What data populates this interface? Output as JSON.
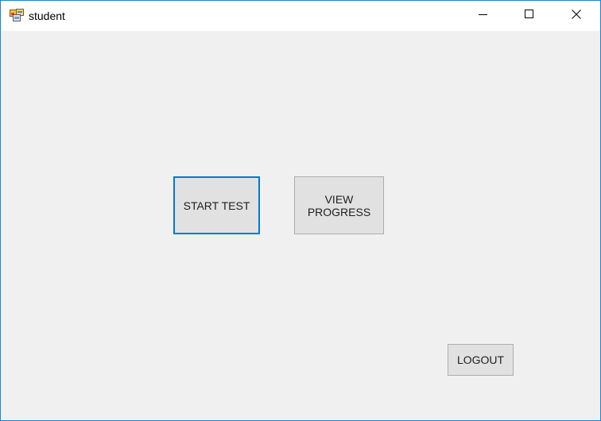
{
  "window": {
    "title": "student",
    "app_icon": "windows-form-icon",
    "controls": {
      "minimize": "minimize-icon",
      "maximize": "maximize-icon",
      "close": "close-icon"
    },
    "accent_color": "#1883d7"
  },
  "form": {
    "start_test_label": "START TEST",
    "view_progress_label": "VIEW\nPROGRESS",
    "logout_label": "LOGOUT",
    "focused_button": "START TEST",
    "background_color": "#f0f0f0",
    "button_color": "#e1e1e1",
    "focus_color": "#0078d7"
  }
}
